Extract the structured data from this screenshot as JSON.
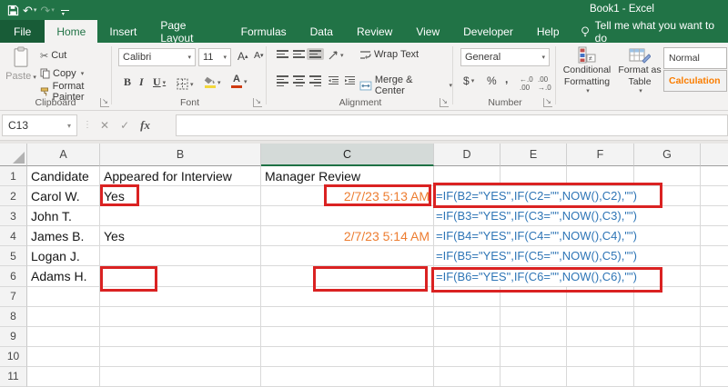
{
  "titlebar": {
    "title": "Book1  -  Excel"
  },
  "ribbon_tabs": {
    "tabs": [
      "File",
      "Home",
      "Insert",
      "Page Layout",
      "Formulas",
      "Data",
      "Review",
      "View",
      "Developer",
      "Help"
    ],
    "active_tab": "Home",
    "tellme": "Tell me what you want to do"
  },
  "ribbon": {
    "clipboard": {
      "label": "Clipboard",
      "paste": "Paste",
      "cut": "Cut",
      "copy": "Copy",
      "format_painter": "Format Painter"
    },
    "font": {
      "label": "Font",
      "family": "Calibri",
      "size": "11",
      "bold": "B",
      "italic": "I",
      "underline": "U"
    },
    "alignment": {
      "label": "Alignment",
      "wrap_text": "Wrap Text",
      "merge_center": "Merge & Center"
    },
    "number": {
      "label": "Number",
      "format": "General",
      "currency": "$",
      "percent": "%",
      "comma": ","
    },
    "styles": {
      "conditional_formatting": "Conditional Formatting",
      "format_as_table": "Format as Table",
      "style_normal": "Normal",
      "style_calculation": "Calculation"
    }
  },
  "formula_bar": {
    "name_box": "C13",
    "fx": "fx",
    "value": ""
  },
  "sheet": {
    "columns": [
      "A",
      "B",
      "C",
      "D",
      "E",
      "F",
      "G"
    ],
    "selected_column": "C",
    "rows": [
      {
        "n": "1",
        "cells": {
          "A": "Candidate",
          "B": "Appeared for Interview",
          "C": "Manager Review"
        }
      },
      {
        "n": "2",
        "cells": {
          "A": "Carol W.",
          "B": "Yes",
          "C": "2/7/23 5:13 AM",
          "D": "=IF(B2=\"YES\",IF(C2=\"\",NOW(),C2),\"\")"
        }
      },
      {
        "n": "3",
        "cells": {
          "A": "John T.",
          "B": "",
          "C": "",
          "D": "=IF(B3=\"YES\",IF(C3=\"\",NOW(),C3),\"\")"
        }
      },
      {
        "n": "4",
        "cells": {
          "A": "James B.",
          "B": "Yes",
          "C": "2/7/23 5:14 AM",
          "D": "=IF(B4=\"YES\",IF(C4=\"\",NOW(),C4),\"\")"
        }
      },
      {
        "n": "5",
        "cells": {
          "A": "Logan J.",
          "B": "",
          "C": "",
          "D": "=IF(B5=\"YES\",IF(C5=\"\",NOW(),C5),\"\")"
        }
      },
      {
        "n": "6",
        "cells": {
          "A": "Adams H.",
          "B": "",
          "C": "",
          "D": "=IF(B6=\"YES\",IF(C6=\"\",NOW(),C6),\"\")"
        }
      },
      {
        "n": "7",
        "cells": {}
      },
      {
        "n": "8",
        "cells": {}
      },
      {
        "n": "9",
        "cells": {}
      },
      {
        "n": "10",
        "cells": {}
      },
      {
        "n": "11",
        "cells": {}
      }
    ]
  },
  "annotations": {
    "color": "#da2222",
    "highlighted_cells": [
      "B2",
      "C2",
      "D2",
      "B6",
      "C6",
      "D6"
    ]
  },
  "colors": {
    "excel_green": "#217346",
    "date_orange": "#ed7d31",
    "formula_blue": "#2e75b6",
    "annotation_red": "#da2222",
    "calculation_style_orange": "#fa7d00"
  }
}
